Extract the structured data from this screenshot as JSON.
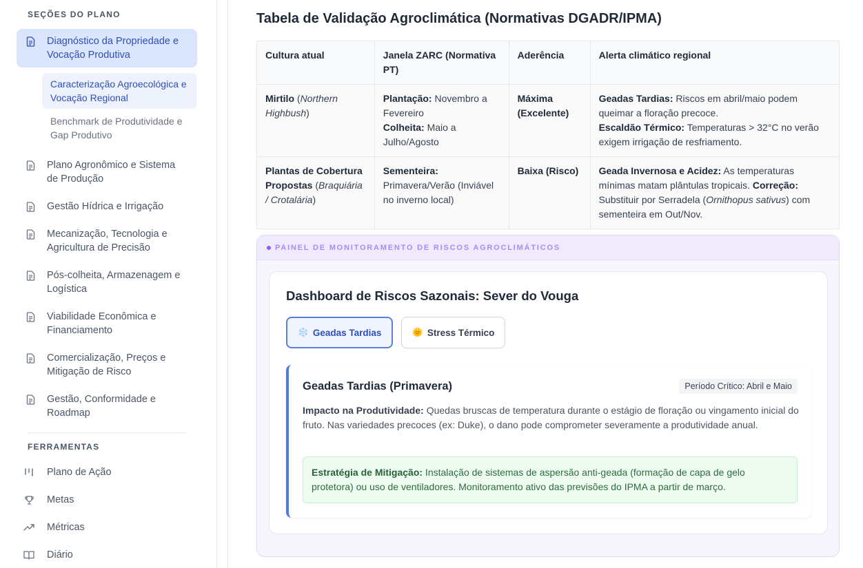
{
  "sidebar": {
    "section_title": "SEÇÕES DO PLANO",
    "items": [
      {
        "label": "Diagnóstico da Propriedade e Vocação Produtiva",
        "icon": "document-icon"
      },
      {
        "label": "Plano Agronômico e Sistema de Produção",
        "icon": "document-icon"
      },
      {
        "label": "Gestão Hídrica e Irrigação",
        "icon": "document-icon"
      },
      {
        "label": "Mecanização, Tecnologia e Agricultura de Precisão",
        "icon": "document-icon"
      },
      {
        "label": "Pós-colheita, Armazenagem e Logística",
        "icon": "document-icon"
      },
      {
        "label": "Viabilidade Econômica e Financiamento",
        "icon": "document-icon"
      },
      {
        "label": "Comercialização, Preços e Mitigação de Risco",
        "icon": "document-icon"
      },
      {
        "label": "Gestão, Conformidade e Roadmap",
        "icon": "document-icon"
      }
    ],
    "sub_items": [
      {
        "label": "Caracterização Agroecológica e Vocação Regional"
      },
      {
        "label": "Benchmark de Produtividade e Gap Produtivo"
      }
    ],
    "tools_title": "FERRAMENTAS",
    "tools": [
      {
        "label": "Plano de Ação",
        "icon": "kanban-icon"
      },
      {
        "label": "Metas",
        "icon": "trophy-icon"
      },
      {
        "label": "Métricas",
        "icon": "trend-up-icon"
      },
      {
        "label": "Diário",
        "icon": "book-icon"
      }
    ]
  },
  "main": {
    "title": "Tabela de Validação Agroclimática (Normativas DGADR/IPMA)",
    "table": {
      "headers": [
        "Cultura atual",
        "Janela ZARC (Normativa PT)",
        "Aderência",
        "Alerta climático regional"
      ],
      "rows": [
        {
          "c1_bold": "Mirtilo",
          "c1_rest_a": " (",
          "c1_italic": "Northern Highbush",
          "c1_rest_b": ")",
          "c2_l1_bold": "Plantação:",
          "c2_l1": " Novembro a Fevereiro",
          "c2_l2_bold": "Colheita:",
          "c2_l2": " Maio a Julho/Agosto",
          "c3": "Máxima (Excelente)",
          "c4_l1_bold": "Geadas Tardias:",
          "c4_l1": " Riscos em abril/maio podem queimar a floração precoce.",
          "c4_l2_bold": "Escaldão Térmico:",
          "c4_l2": " Temperaturas > 32°C no verão exigem irrigação de resfriamento."
        },
        {
          "c1_bold": "Plantas de Cobertura Propostas",
          "c1_rest_a": " (",
          "c1_italic": "Braquiária / Crotalária",
          "c1_rest_b": ")",
          "c2_l1_bold": "Sementeira:",
          "c2_l1": " Primavera/Verão (Inviável no inverno local)",
          "c3": "Baixa (Risco)",
          "c4_l1_bold": "Geada Invernosa e Acidez:",
          "c4_l1": " As temperaturas mínimas matam plântulas tropicais. ",
          "c4_l2_bold": "Correção:",
          "c4_l2a": " Substituir por Serradela (",
          "c4_l2_italic": "Ornithopus sativus",
          "c4_l2b": ") com sementeira em Out/Nov."
        }
      ]
    },
    "panel": {
      "label": "PAINEL DE MONITORAMENTO DE RISCOS AGROCLIMÁTICOS",
      "dashboard_title": "Dashboard de Riscos Sazonais: Sever do Vouga",
      "tabs": [
        {
          "emoji": "❄️",
          "label": "Geadas Tardias",
          "active": true
        },
        {
          "emoji": "🌞",
          "label": "Stress Térmico",
          "active": false
        }
      ],
      "risk": {
        "title": "Geadas Tardias (Primavera)",
        "badge": "Período Crítico: Abril e Maio",
        "impact_label": "Impacto na Produtividade:",
        "impact_text": " Quedas bruscas de temperatura durante o estágio de floração ou vingamento inicial do fruto. Nas variedades precoces (ex: Duke), o dano pode comprometer severamente a produtividade anual.",
        "mitigation_label": "Estratégia de Mitigação:",
        "mitigation_text": " Instalação de sistemas de aspersão anti-geada (formação de capa de gelo protetora) ou uso de ventiladores. Monitoramento ativo das previsões do IPMA a partir de março."
      }
    }
  },
  "colors": {
    "accent": "#2e4fb7",
    "active_bg": "#dbe5fb",
    "panel_purple": "#a78bfa",
    "mitigation_green": "#2f6b41"
  }
}
